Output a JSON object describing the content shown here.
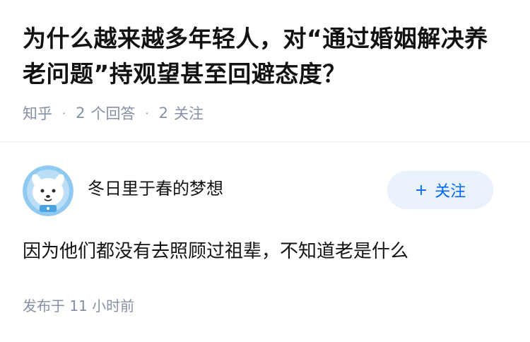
{
  "question": {
    "title": "为什么越来越多年轻人，对“通过婚姻解决养老问题”持观望甚至回避态度？",
    "source": "知乎",
    "answers_count": "2",
    "answers_label": "个回答",
    "follow_count": "2",
    "follow_label": "关注"
  },
  "answer": {
    "author": {
      "name": "冬日里于春的梦想",
      "avatar_icon": "cartoon-astronaut-avatar-icon"
    },
    "follow_button": {
      "plus": "+",
      "label": "关注"
    },
    "content": "因为他们都没有去照顾过祖辈，不知道老是什么",
    "publish_label": "发布于",
    "publish_time": "11 小时前"
  },
  "colors": {
    "title": "#121212",
    "meta": "#8590a6",
    "accent": "#0066ff",
    "follow_bg": "#e9f1fa"
  }
}
